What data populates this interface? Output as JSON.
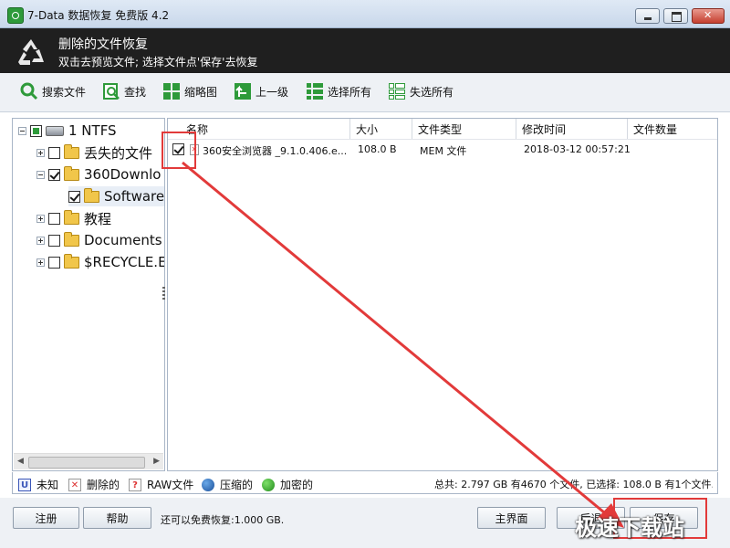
{
  "window": {
    "title": "7-Data 数据恢复 免费版 4.2"
  },
  "header": {
    "title": "删除的文件恢复",
    "subtitle": "双击去预览文件; 选择文件点'保存'去恢复"
  },
  "toolbar": [
    {
      "label": "搜索文件",
      "icon": "search-file-icon"
    },
    {
      "label": "查找",
      "icon": "find-icon"
    },
    {
      "label": "缩略图",
      "icon": "thumbnail-icon"
    },
    {
      "label": "上一级",
      "icon": "up-level-icon"
    },
    {
      "label": "选择所有",
      "icon": "select-all-icon"
    },
    {
      "label": "失选所有",
      "icon": "deselect-all-icon"
    }
  ],
  "tree": [
    {
      "label": "1 NTFS",
      "icon": "drive-icon"
    },
    {
      "label": "丢失的文件",
      "icon": "lost-folder-icon"
    },
    {
      "label": "360Downlo",
      "icon": "folder-icon"
    },
    {
      "label": "Software",
      "icon": "folder-icon"
    },
    {
      "label": "教程",
      "icon": "folder-icon"
    },
    {
      "label": "Documents",
      "icon": "folder-icon"
    },
    {
      "label": "$RECYCLE.E",
      "icon": "folder-icon"
    }
  ],
  "columns": [
    "名称",
    "大小",
    "文件类型",
    "修改时间",
    "文件数量"
  ],
  "files": [
    {
      "name": "360安全浏览器 _9.1.0.406.e...",
      "size": "108.0 B",
      "type": "MEM 文件",
      "modified": "2018-03-12 00:57:21",
      "count": ""
    }
  ],
  "legend": [
    {
      "label": "未知",
      "icon": "unknown-icon"
    },
    {
      "label": "删除的",
      "icon": "deleted-icon"
    },
    {
      "label": "RAW文件",
      "icon": "raw-file-icon"
    },
    {
      "label": "压缩的",
      "icon": "compressed-icon"
    },
    {
      "label": "加密的",
      "icon": "encrypted-icon"
    }
  ],
  "status": "总共: 2.797 GB 有4670 个文件, 已选择: 108.0 B 有1个文件.",
  "buttons": {
    "register": "注册",
    "help": "帮助",
    "main": "主界面",
    "back": "后退",
    "save": "保存"
  },
  "free_quota": "还可以免费恢复:1.000 GB.",
  "watermark": "极速下载站",
  "colors": {
    "accent": "#2e9a3a",
    "annotation": "#e23a3a",
    "header_bg": "#1f1f1f"
  }
}
